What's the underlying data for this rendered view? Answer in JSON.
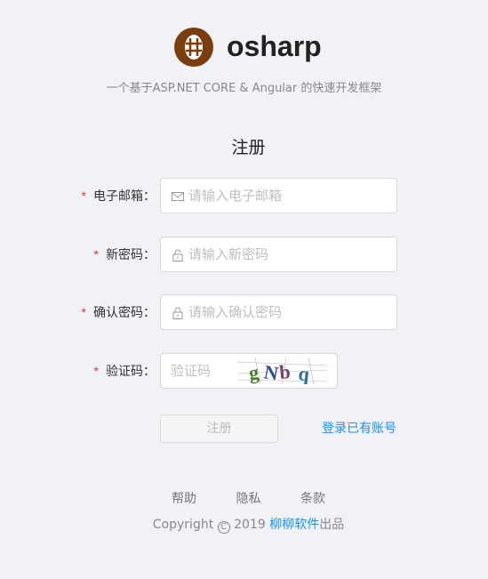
{
  "brand": {
    "name": "osharp",
    "tagline": "一个基于ASP.NET CORE & Angular 的快速开发框架"
  },
  "form": {
    "title": "注册",
    "fields": [
      {
        "label": "电子邮箱：",
        "placeholder": "请输入电子邮箱",
        "icon": "mail-icon"
      },
      {
        "label": "新密码：",
        "placeholder": "请输入新密码",
        "icon": "lock-icon"
      },
      {
        "label": "确认密码：",
        "placeholder": "请输入确认密码",
        "icon": "lock-icon"
      },
      {
        "label": "验证码：",
        "placeholder": "验证码",
        "captcha_text": "gNbq"
      }
    ],
    "required_mark": "*",
    "submit_label": "注册",
    "login_link": "登录已有账号"
  },
  "footer": {
    "links": [
      "帮助",
      "隐私",
      "条款"
    ],
    "copyright_prefix": "Copyright",
    "copyright_symbol": "C",
    "year": "2019",
    "company": "柳柳软件",
    "suffix": "出品"
  },
  "colors": {
    "background": "#f0f2f5",
    "link": "#1890ff",
    "required": "#d9363e",
    "logo": "#7a3d10"
  }
}
